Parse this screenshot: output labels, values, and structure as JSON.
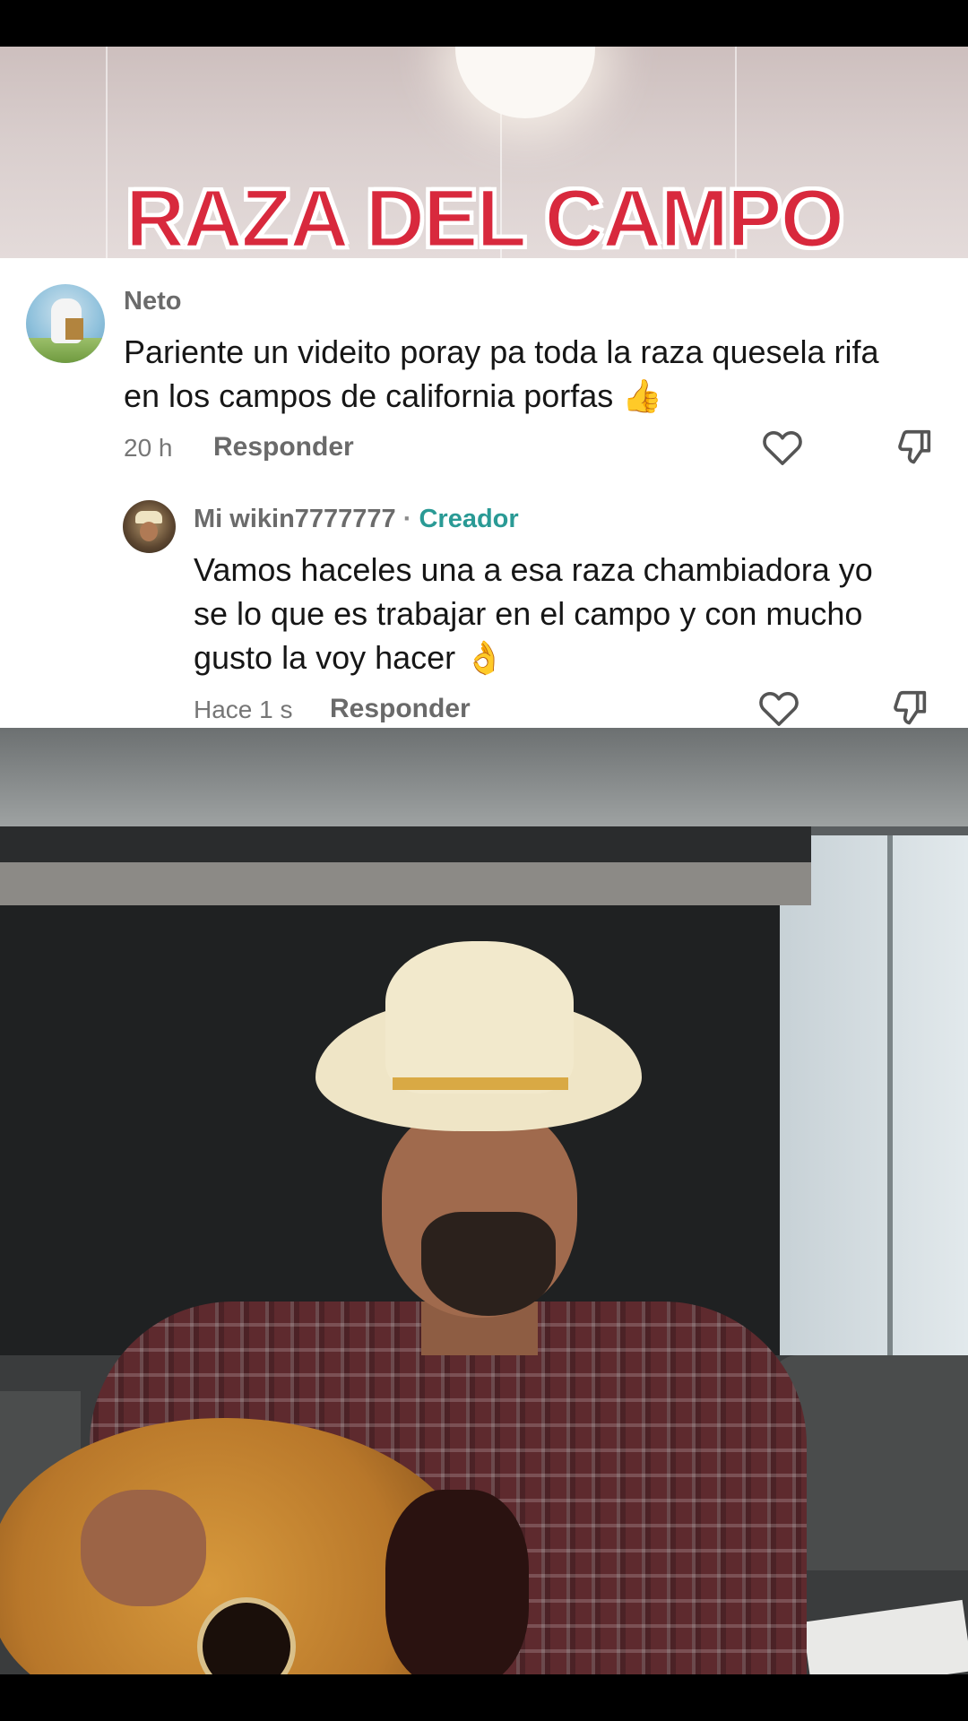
{
  "overlay": {
    "title": "RAZA DEL CAMPO"
  },
  "comment": {
    "username": "Neto",
    "text_line1": "Pariente un videito poray pa toda la raza quesela rifa",
    "text_line2": "en los campos de california porfas 👍",
    "time": "20 h",
    "reply_label": "Responder",
    "avatar_icon": "beekeeper-avatar"
  },
  "reply": {
    "username": "Mi wikin7777777",
    "separator": "·",
    "creator_label": "Creador",
    "text_line1": "Vamos haceles una a esa raza chambiadora yo",
    "text_line2": "se lo que es trabajar en el campo y con mucho",
    "text_line3": "gusto la voy hacer 👌",
    "time": "Hace 1 s",
    "reply_label": "Responder",
    "avatar_icon": "cowboy-avatar"
  },
  "icons": {
    "like": "heart-outline-icon",
    "dislike": "thumbs-down-icon"
  },
  "colors": {
    "title_red": "#d8293d",
    "creator_teal": "#2a9a95",
    "text_dark": "#161616",
    "meta_gray": "#767676"
  }
}
